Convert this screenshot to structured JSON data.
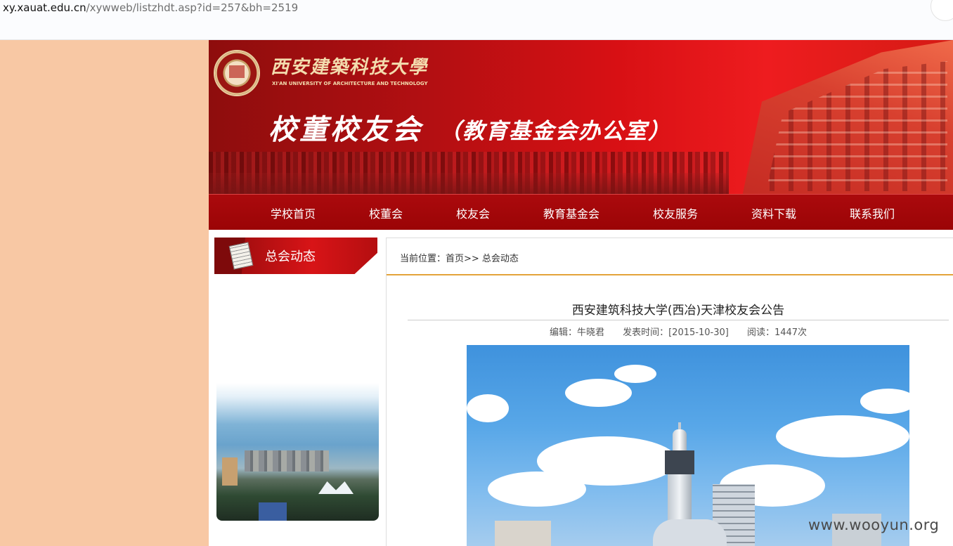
{
  "browser": {
    "url_host": "xy.xauat.edu.cn",
    "url_path": "/xywweb/listzhdt.asp?id=257&bh=2519"
  },
  "banner": {
    "university_name": "西安建築科技大學",
    "university_name_en": "XI'AN UNIVERSITY OF ARCHITECTURE AND TECHNOLOGY",
    "title": "校董校友会",
    "subtitle": "（教育基金会办公室）"
  },
  "nav": {
    "items": [
      {
        "label": "学校首页"
      },
      {
        "label": "校董会"
      },
      {
        "label": "校友会"
      },
      {
        "label": "教育基金会"
      },
      {
        "label": "校友服务"
      },
      {
        "label": "资料下载"
      },
      {
        "label": "联系我们"
      }
    ]
  },
  "sidebar": {
    "title": "总会动态",
    "icon": "document-icon"
  },
  "breadcrumb": {
    "text": "当前位置：首页>> 总会动态"
  },
  "article": {
    "title": "西安建筑科技大学(西冶)天津校友会公告",
    "editor": "编辑：牛晓君",
    "published": "发表时间：[2015-10-30]",
    "views": "阅读：1447次"
  },
  "watermark": "www.wooyun.org",
  "colors": {
    "page_background": "#f8c8a4",
    "nav_red": "#a0070a",
    "breadcrumb_rule": "#e3a33a"
  }
}
